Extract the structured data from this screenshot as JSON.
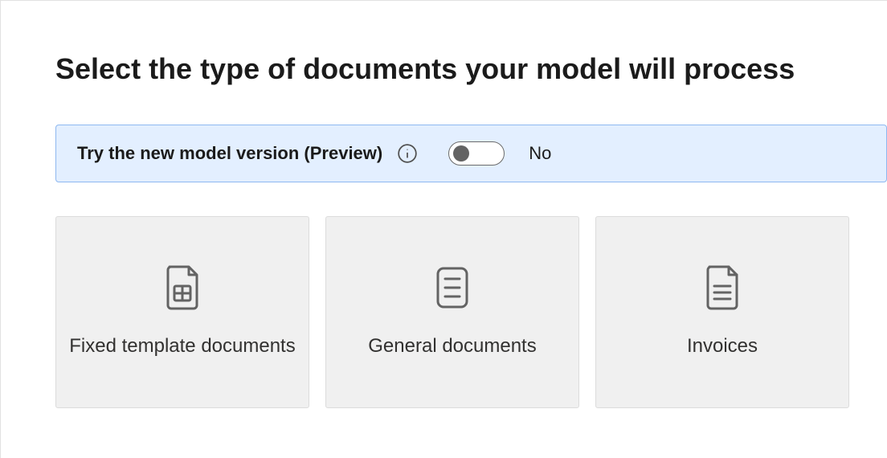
{
  "title": "Select the type of documents your model will process",
  "banner": {
    "label": "Try the new model version (Preview)",
    "toggle_state": "No"
  },
  "cards": [
    {
      "label": "Fixed template documents"
    },
    {
      "label": "General documents"
    },
    {
      "label": "Invoices"
    }
  ]
}
